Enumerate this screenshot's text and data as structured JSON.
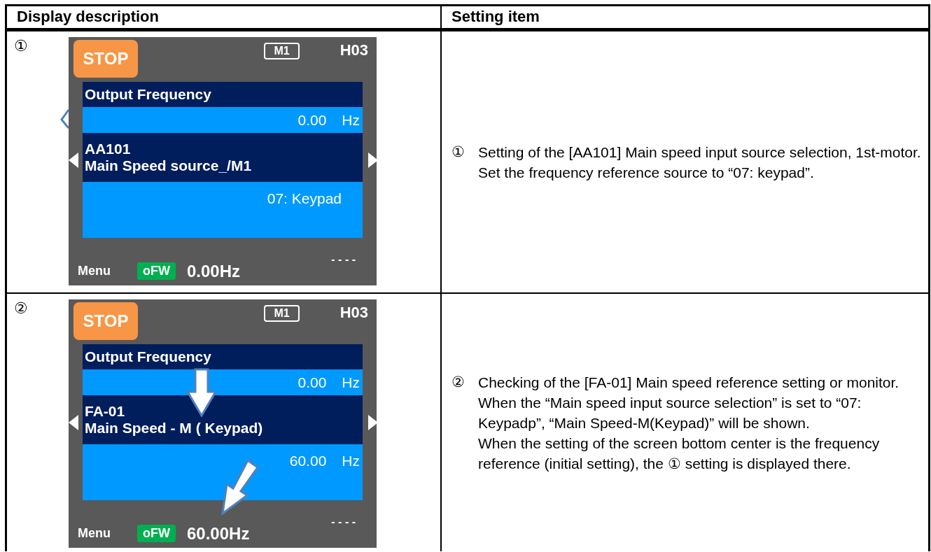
{
  "table": {
    "columns": [
      "Display description",
      "Setting item"
    ],
    "rows": [
      {
        "mark": "①",
        "screen": {
          "status": "STOP",
          "motor": "M1",
          "code": "H03",
          "monitor_title": "Output Frequency",
          "monitor_value": "0.00",
          "monitor_unit": "Hz",
          "param_code": "AA101",
          "param_name": "Main Speed source_/M1",
          "param_value": "07: Keypad",
          "footer_menu": "Menu",
          "footer_direction": "oFW",
          "footer_value": "0.00Hz",
          "footer_dashes": "- - - -",
          "arrows": [
            {
              "kind": "partial"
            }
          ]
        },
        "description": {
          "mark": "①",
          "paragraphs": [
            "Setting of the [AA101] Main speed input source selection, 1st-motor.",
            "Set the frequency reference source to “07: keypad”."
          ]
        }
      },
      {
        "mark": "②",
        "screen": {
          "status": "STOP",
          "motor": "M1",
          "code": "H03",
          "monitor_title": "Output Frequency",
          "monitor_value": "0.00",
          "monitor_unit": "Hz",
          "param_code": "FA-01",
          "param_name": "Main Speed - M ( Keypad)",
          "param_value": "60.00",
          "param_unit": "Hz",
          "footer_menu": "Menu",
          "footer_direction": "oFW",
          "footer_value": "60.00Hz",
          "footer_dashes": "- - - -",
          "arrows": [
            {
              "kind": "down"
            },
            {
              "kind": "diagonal"
            }
          ]
        },
        "description": {
          "mark": "②",
          "paragraphs": [
            "Checking of the [FA-01] Main speed reference setting or monitor.",
            "When the “Main speed input source selection” is set to “07: Keypadp”, “Main Speed-M(Keypad)” will be shown.",
            "When the setting of the screen bottom center is the frequency reference (initial setting), the ① setting is displayed there."
          ]
        }
      }
    ]
  }
}
